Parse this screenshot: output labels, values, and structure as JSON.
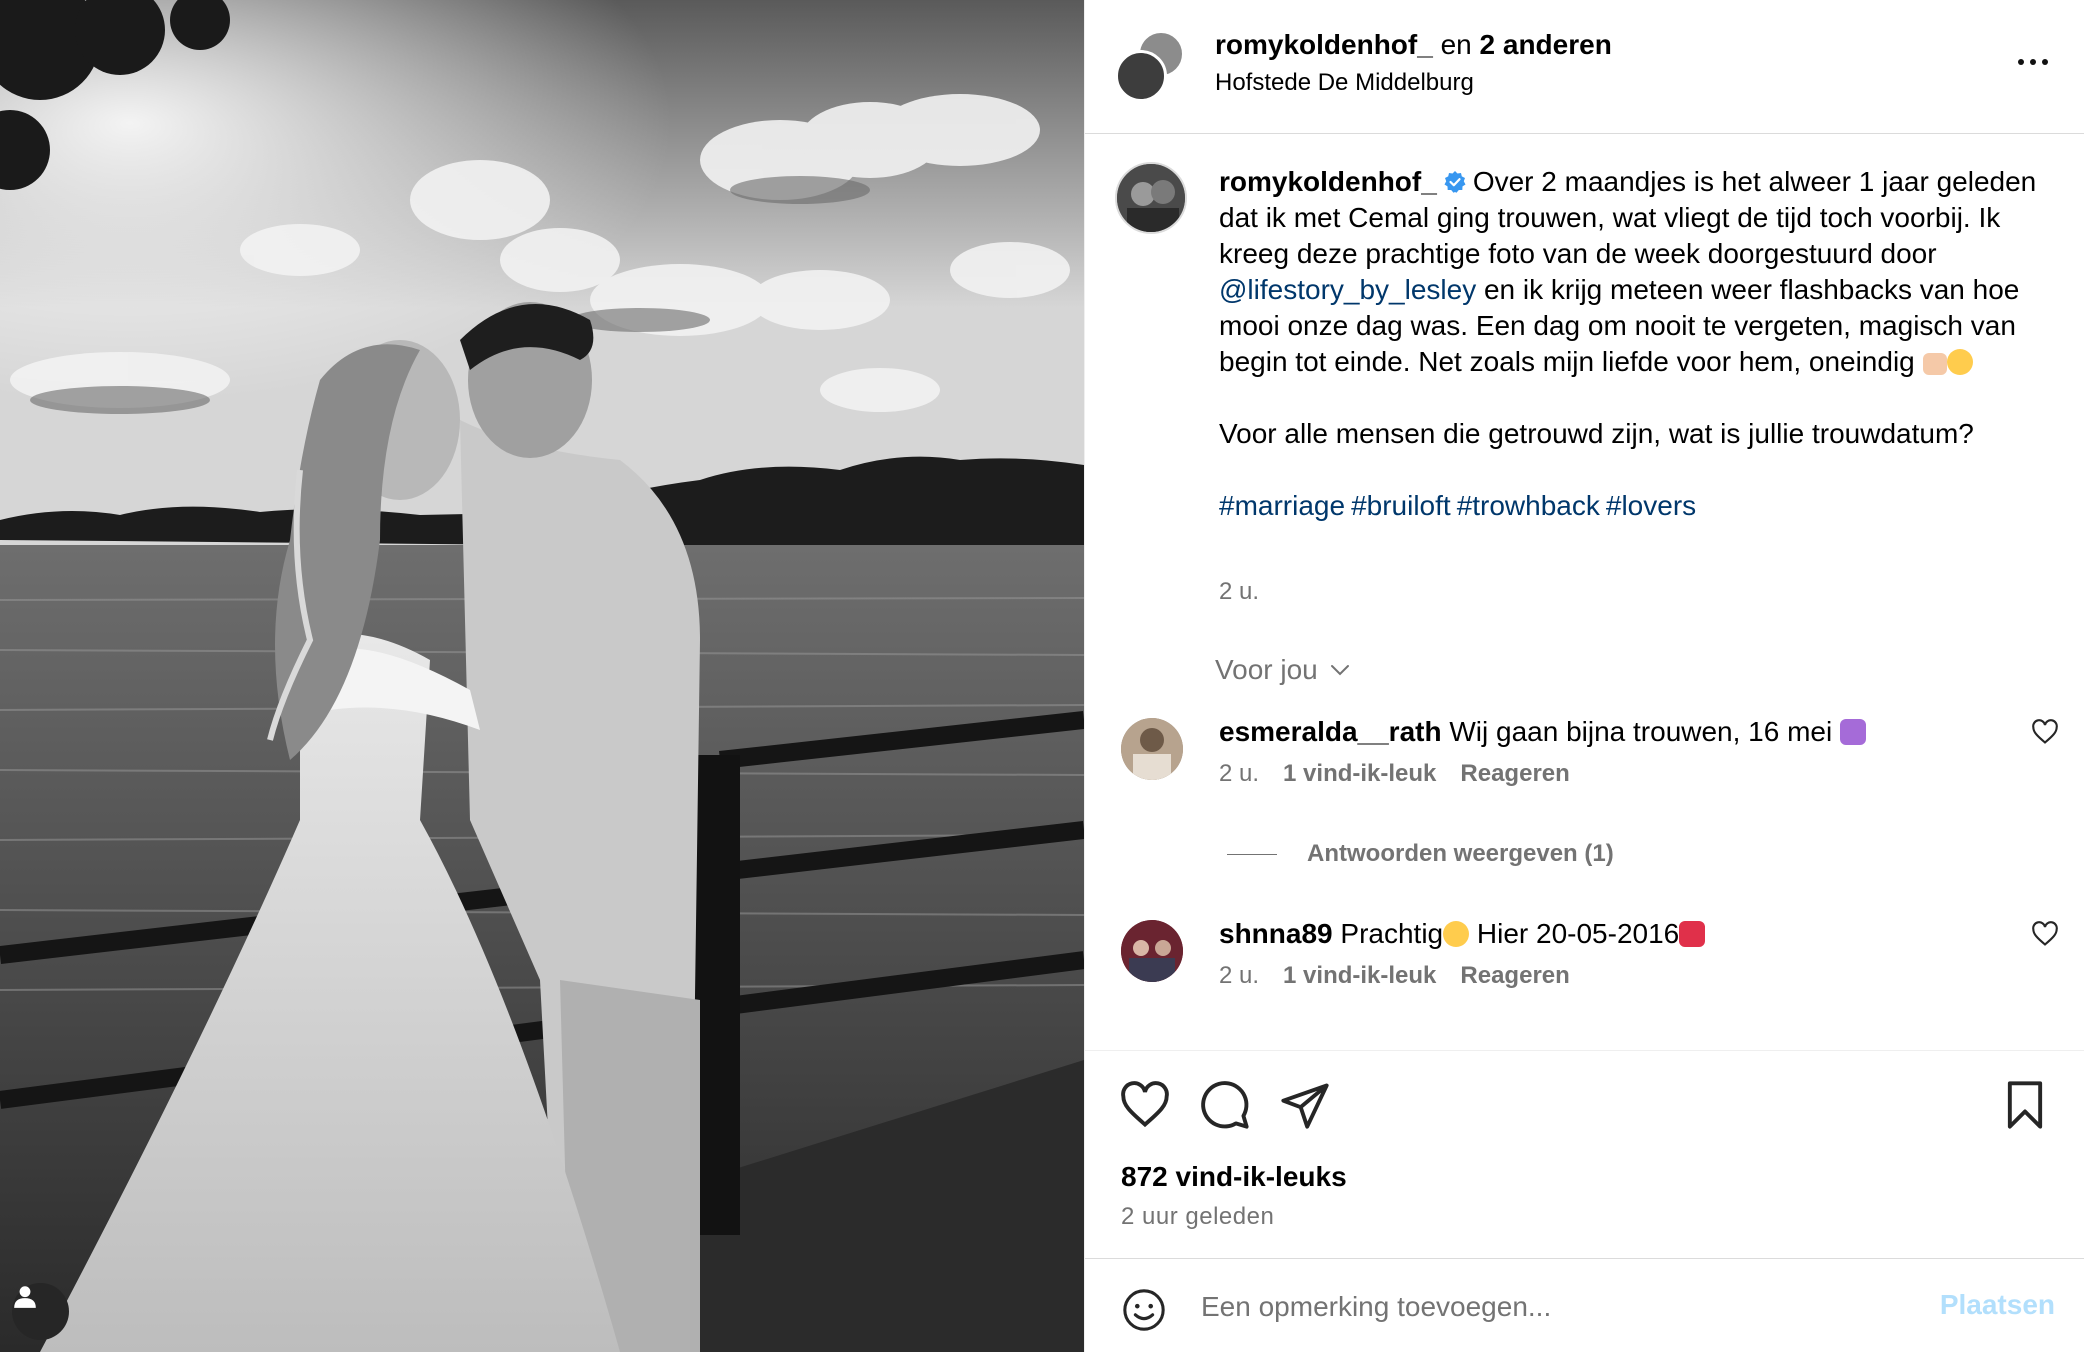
{
  "header": {
    "username": "romykoldenhof_",
    "collab_connector": "en",
    "collab_others": "2 anderen",
    "location": "Hofstede De Middelburg"
  },
  "caption": {
    "username": "romykoldenhof_",
    "text_1": "Over 2 maandjes is het alweer 1 jaar geleden dat ik met Cemal ging trouwen, wat vliegt de tijd toch voorbij. Ik kreeg deze prachtige foto van de week doorgestuurd door",
    "mention": "@lifestory_by_lesley",
    "text_2": "en ik krijg meteen weer flashbacks van hoe mooi onze dag was. Een dag om nooit te vergeten, magisch van begin tot einde. Net zoals mijn liefde voor hem, oneindig",
    "text_3": "Voor alle mensen die getrouwd zijn, wat is jullie trouwdatum?",
    "hashtags": [
      "#marriage",
      "#bruiloft",
      "#trowhback",
      "#lovers"
    ],
    "time": "2 u."
  },
  "filter": {
    "label": "Voor jou"
  },
  "comments": [
    {
      "username": "esmeralda__rath",
      "text": "Wij gaan bijna trouwen, 16 mei",
      "time": "2 u.",
      "likes": "1 vind-ik-leuk",
      "reply": "Reageren",
      "view_replies": "Antwoorden weergeven (1)"
    },
    {
      "username": "shnna89",
      "text_a": "Prachtig",
      "text_b": "Hier 20-05-2016",
      "time": "2 u.",
      "likes": "1 vind-ik-leuk",
      "reply": "Reageren"
    }
  ],
  "stats": {
    "likes": "872 vind-ik-leuks",
    "posted": "2 uur geleden"
  },
  "composer": {
    "placeholder": "Een opmerking toevoegen...",
    "post_label": "Plaatsen"
  },
  "colors": {
    "link": "#00376b",
    "muted": "#737373",
    "verified": "#3897f0",
    "post_disabled": "#b2dffc"
  },
  "icons": [
    "more-icon",
    "verified-icon",
    "chevron-down-icon",
    "heart-icon",
    "comment-icon",
    "share-icon",
    "bookmark-icon",
    "emoji-icon",
    "user-tag-icon"
  ]
}
